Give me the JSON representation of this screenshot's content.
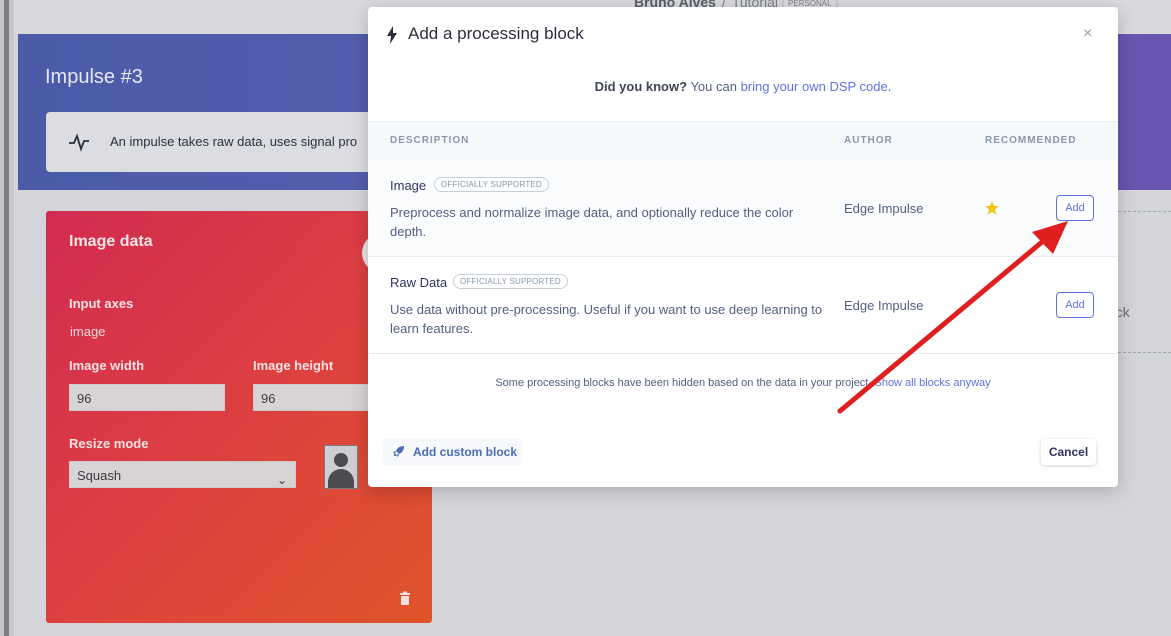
{
  "breadcrumb": {
    "user": "Bruno Alves",
    "project": "Tutorial",
    "badge": "PERSONAL"
  },
  "page": {
    "title": "Impulse #3",
    "info_text": "An impulse takes raw data, uses signal pro"
  },
  "image_block": {
    "title": "Image data",
    "input_axes_label": "Input axes",
    "input_axes_value": "image",
    "width_label": "Image width",
    "width_value": "96",
    "height_label": "Image height",
    "height_value": "96",
    "resize_label": "Resize mode",
    "resize_value": "Squash"
  },
  "right_partial_text": "ock",
  "modal": {
    "title": "Add a processing block",
    "close": "×",
    "tip_bold": "Did you know?",
    "tip_text": " You can ",
    "tip_link": "bring your own DSP code",
    "tip_end": ".",
    "columns": {
      "description": "DESCRIPTION",
      "author": "AUTHOR",
      "recommended": "RECOMMENDED"
    },
    "blocks": [
      {
        "name": "Image",
        "badge": "OFFICIALLY SUPPORTED",
        "description": "Preprocess and normalize image data, and optionally reduce the color depth.",
        "author": "Edge Impulse",
        "recommended": true,
        "add_label": "Add"
      },
      {
        "name": "Raw Data",
        "badge": "OFFICIALLY SUPPORTED",
        "description": "Use data without pre-processing. Useful if you want to use deep learning to learn features.",
        "author": "Edge Impulse",
        "recommended": false,
        "add_label": "Add"
      }
    ],
    "hidden_note": "Some processing blocks have been hidden based on the data in your project. ",
    "hidden_link": "Show all blocks anyway",
    "custom_block_label": "Add custom block",
    "cancel_label": "Cancel"
  },
  "colors": {
    "accent": "#5e72e4",
    "banner_start": "#4b5ba8",
    "card_start": "#d12b51",
    "card_end": "#e0542a",
    "star": "#f5c518",
    "annotation_arrow": "#e0201f"
  },
  "icons": {
    "pulse": "pulse-icon",
    "bolt": "bolt-icon",
    "close": "close-icon",
    "star": "star-icon",
    "rocket": "rocket-icon",
    "trash": "trash-icon",
    "chevron": "chevron-down-icon",
    "portrait": "person-placeholder-icon"
  }
}
